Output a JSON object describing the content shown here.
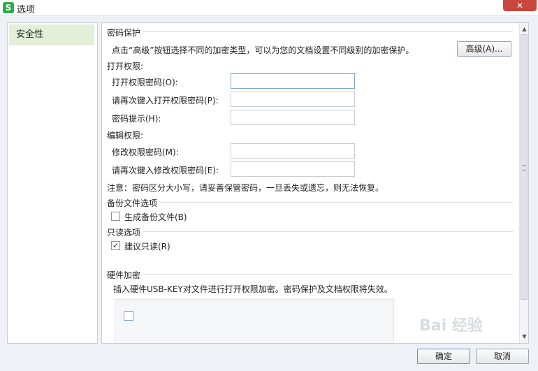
{
  "window": {
    "app_icon_glyph": "S",
    "title": "选项",
    "close_label": "✕"
  },
  "sidebar": {
    "items": [
      {
        "label": "安全性"
      }
    ]
  },
  "password": {
    "section_title": "密码保护",
    "description": "点击“高级”按钮选择不同的加密类型，可以为您的文档设置不同级别的加密保护。",
    "advanced_button": "高级(A)...",
    "open_group_label": "打开权限:",
    "open_password_label": "打开权限密码(O):",
    "open_password_confirm_label": "请再次键入打开权限密码(P):",
    "hint_label": "密码提示(H):",
    "edit_group_label": "编辑权限:",
    "modify_password_label": "修改权限密码(M):",
    "modify_password_confirm_label": "请再次键入修改权限密码(E):",
    "note": "注意：密码区分大小写，请妥善保管密码，一旦丢失或遗忘，则无法恢复。"
  },
  "backup": {
    "section_title": "备份文件选项",
    "checkbox_label": "生成备份文件(B)",
    "checked": false
  },
  "readonly": {
    "section_title": "只读选项",
    "checkbox_label": "建议只读(R)",
    "checked": true
  },
  "hardware": {
    "section_title": "硬件加密",
    "description": "插入硬件USB-KEY对文件进行打开权限加密。密码保护及文档权限将失效。"
  },
  "footer": {
    "ok_label": "确定",
    "cancel_label": "取消"
  },
  "watermark": {
    "text": "Bai 经验"
  }
}
